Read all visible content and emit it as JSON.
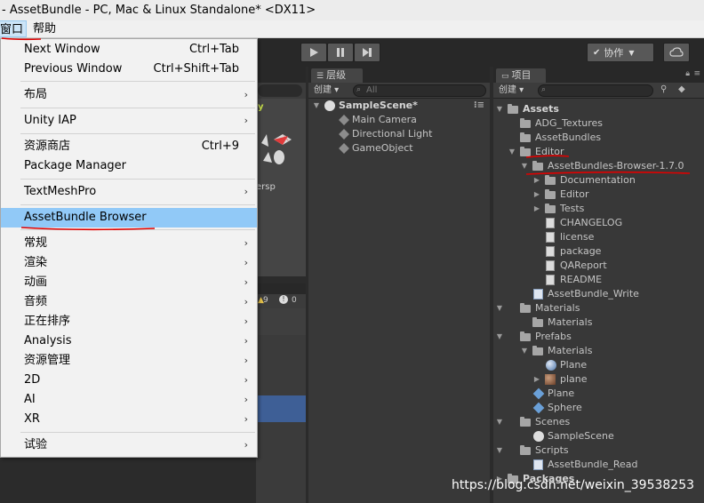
{
  "window": {
    "title": "- AssetBundle - PC, Mac & Linux Standalone* <DX11>"
  },
  "menubar": {
    "items": [
      {
        "label": "窗口"
      },
      {
        "label": "帮助"
      }
    ]
  },
  "toolbar": {
    "collab_label": "协作"
  },
  "menu": {
    "items": [
      {
        "label": "Next Window",
        "shortcut": "Ctrl+Tab"
      },
      {
        "label": "Previous Window",
        "shortcut": "Ctrl+Shift+Tab"
      },
      {
        "label": "布局",
        "submenu": "›"
      },
      {
        "label": "Unity IAP",
        "submenu": "›"
      },
      {
        "label": "资源商店",
        "shortcut": "Ctrl+9"
      },
      {
        "label": "Package Manager"
      },
      {
        "label": "TextMeshPro",
        "submenu": "›"
      },
      {
        "label": "AssetBundle Browser"
      },
      {
        "label": "常规",
        "submenu": "›"
      },
      {
        "label": "渲染",
        "submenu": "›"
      },
      {
        "label": "动画",
        "submenu": "›"
      },
      {
        "label": "音频",
        "submenu": "›"
      },
      {
        "label": "正在排序",
        "submenu": "›"
      },
      {
        "label": "Analysis",
        "submenu": "›"
      },
      {
        "label": "资源管理",
        "submenu": "›"
      },
      {
        "label": "2D",
        "submenu": "›"
      },
      {
        "label": "AI",
        "submenu": "›"
      },
      {
        "label": "XR",
        "submenu": "›"
      },
      {
        "label": "试验",
        "submenu": "›"
      }
    ]
  },
  "scene": {
    "gizmo_axis": "y",
    "persp_label": "ersp",
    "warn_count": "9",
    "error_count": "0"
  },
  "hierarchy": {
    "tab": "层级",
    "create": "创建 ▾",
    "search_placeholder": "All",
    "scene": "SampleScene*",
    "items": [
      "Main Camera",
      "Directional Light",
      "GameObject"
    ]
  },
  "project": {
    "tab": "项目",
    "create": "创建 ▾",
    "tree": [
      {
        "label": "Assets",
        "bold": true
      },
      {
        "label": "ADG_Textures"
      },
      {
        "label": "AssetBundles"
      },
      {
        "label": "Editor"
      },
      {
        "label": "AssetBundles-Browser-1.7.0"
      },
      {
        "label": "Documentation"
      },
      {
        "label": "Editor"
      },
      {
        "label": "Tests"
      },
      {
        "label": "CHANGELOG"
      },
      {
        "label": "license"
      },
      {
        "label": "package"
      },
      {
        "label": "QAReport"
      },
      {
        "label": "README"
      },
      {
        "label": "AssetBundle_Write"
      },
      {
        "label": "Materials"
      },
      {
        "label": "Materials"
      },
      {
        "label": "Prefabs"
      },
      {
        "label": "Materials"
      },
      {
        "label": "Plane"
      },
      {
        "label": "plane"
      },
      {
        "label": "Plane"
      },
      {
        "label": "Sphere"
      },
      {
        "label": "Scenes"
      },
      {
        "label": "SampleScene"
      },
      {
        "label": "Scripts"
      },
      {
        "label": "AssetBundle_Read"
      },
      {
        "label": "Packages",
        "bold": true
      }
    ]
  },
  "watermark": "https://blog.csdn.net/weixin_39538253",
  "colors": {
    "menu_highlight": "#91c9f7",
    "annotation": "#e00000",
    "panel_bg": "#383838"
  }
}
